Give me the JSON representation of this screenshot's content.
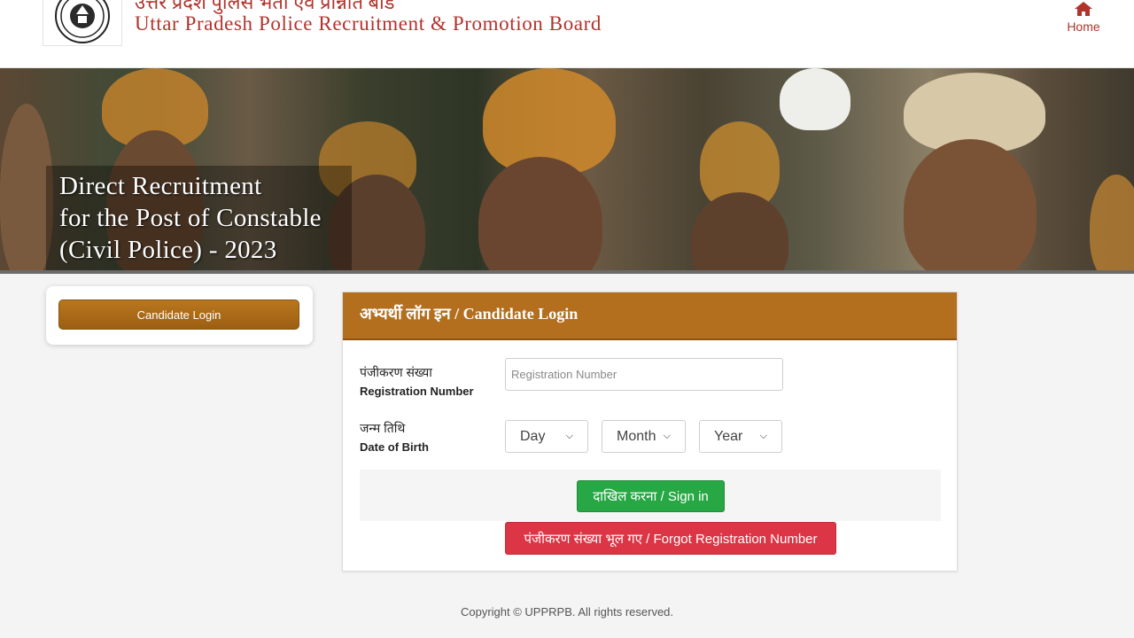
{
  "header": {
    "title_hindi": "उत्तर प्रदेश पुलिस भर्ती एवं प्रोन्नति बोर्ड",
    "title_english": "Uttar Pradesh Police Recruitment & Promotion Board",
    "home_label": "Home"
  },
  "banner": {
    "lines": [
      "Direct Recruitment",
      "for the Post of Constable",
      "(Civil Police) - 2023"
    ]
  },
  "sidebar": {
    "button_label": "Candidate Login"
  },
  "login": {
    "title": "अभ्यर्थी लॉग इन / Candidate Login",
    "reg_label_hindi": "पंजीकरण संख्या",
    "reg_label_english": "Registration Number",
    "reg_placeholder": "Registration Number",
    "dob_label_hindi": "जन्म तिथि",
    "dob_label_english": "Date of Birth",
    "day": "Day",
    "month": "Month",
    "year": "Year",
    "sign_in": "दाखिल करना / Sign in",
    "forgot": "पंजीकरण संख्या भूल गए / Forgot Registration Number"
  },
  "footer": {
    "copyright": "Copyright © UPPRPB. All rights reserved."
  },
  "colors": {
    "brand_red": "#b0342c",
    "header_brown": "#b36f1e",
    "sign_in_green": "#28a745",
    "forgot_red": "#dc3545"
  }
}
